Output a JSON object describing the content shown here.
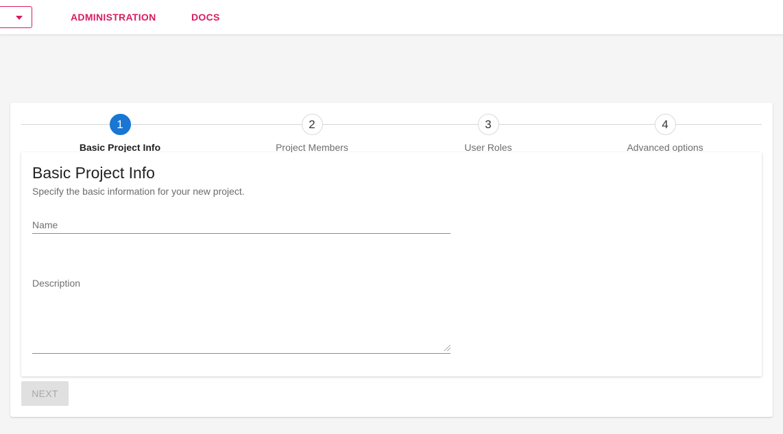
{
  "topbar": {
    "dropdown_icon": "caret-down-icon",
    "nav": [
      {
        "label": "ADMINISTRATION"
      },
      {
        "label": "DOCS"
      }
    ],
    "accent_color": "#d81b60"
  },
  "stepper": {
    "active_color": "#1976d2",
    "steps": [
      {
        "number": "1",
        "label": "Basic Project Info",
        "active": true
      },
      {
        "number": "2",
        "label": "Project Members",
        "active": false
      },
      {
        "number": "3",
        "label": "User Roles",
        "active": false
      },
      {
        "number": "4",
        "label": "Advanced options",
        "active": false
      }
    ]
  },
  "form": {
    "title": "Basic Project Info",
    "subtitle": "Specify the basic information for your new project.",
    "name_label": "Name",
    "name_value": "",
    "description_label": "Description",
    "description_value": ""
  },
  "actions": {
    "next_label": "NEXT",
    "next_disabled": true
  }
}
